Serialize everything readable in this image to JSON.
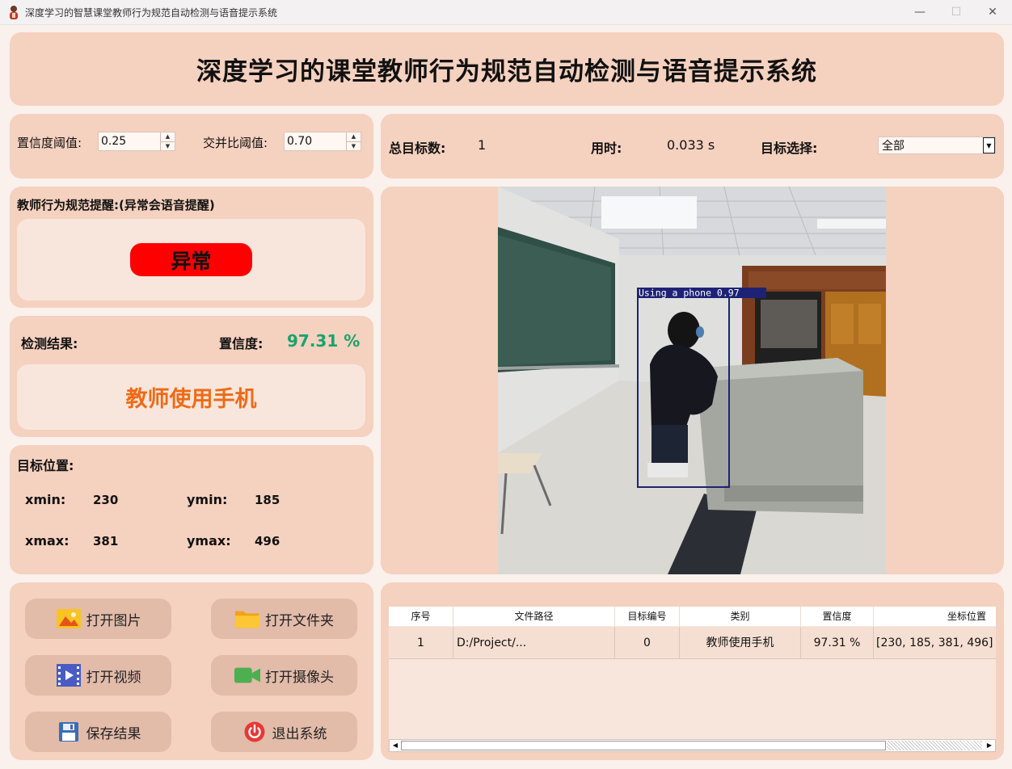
{
  "window": {
    "title": "深度学习的智慧课堂教师行为规范自动检测与语音提示系统",
    "minimize": "—",
    "maximize": "☐",
    "close": "✕"
  },
  "header": {
    "title": "深度学习的课堂教师行为规范自动检测与语音提示系统"
  },
  "params": {
    "confidence_label": "置信度阈值:",
    "confidence_value": "0.25",
    "iou_label": "交并比阈值:",
    "iou_value": "0.70"
  },
  "stats": {
    "total_label": "总目标数:",
    "total_value": "1",
    "time_label": "用时:",
    "time_value": "0.033 s",
    "select_label": "目标选择:",
    "select_value": "全部"
  },
  "reminder": {
    "label": "教师行为规范提醒:(异常会语音提醒)",
    "status": "异常",
    "status_color": "#ff0000"
  },
  "detection": {
    "result_label": "检测结果:",
    "confidence_label": "置信度:",
    "confidence_value": "97.31 %",
    "result_value": "教师使用手机",
    "result_color": "#ee6a16"
  },
  "position": {
    "label": "目标位置:",
    "xmin_label": "xmin:",
    "xmin": "230",
    "ymin_label": "ymin:",
    "ymin": "185",
    "xmax_label": "xmax:",
    "xmax": "381",
    "ymax_label": "ymax:",
    "ymax": "496"
  },
  "image": {
    "box_label": "Using a phone 0.97",
    "box_color": "#1e2275"
  },
  "buttons": {
    "open_image": "打开图片",
    "open_folder": "打开文件夹",
    "open_video": "打开视频",
    "open_camera": "打开摄像头",
    "save": "保存结果",
    "exit": "退出系统"
  },
  "table": {
    "headers": [
      "序号",
      "文件路径",
      "目标编号",
      "类别",
      "置信度",
      "坐标位置"
    ],
    "rows": [
      [
        "1",
        "D:/Project/...",
        "0",
        "教师使用手机",
        "97.31 %",
        "[230, 185, 381, 496]"
      ]
    ]
  }
}
